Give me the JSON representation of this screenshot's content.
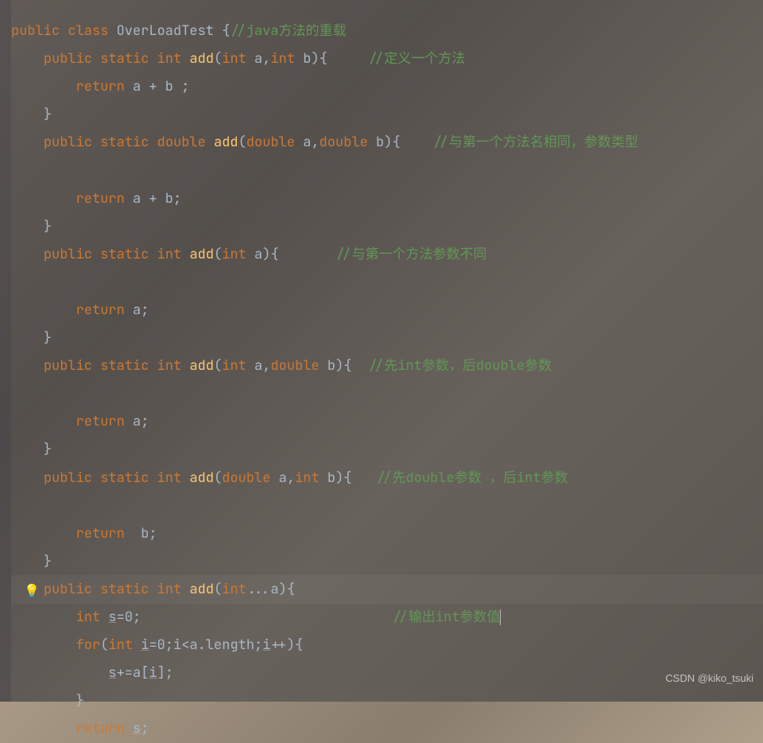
{
  "code": {
    "line1": {
      "kw1": "public",
      "kw2": "class",
      "cls": "OverLoadTest",
      "brace": "{",
      "cmt": "//java方法的重载"
    },
    "line2": {
      "kw1": "public",
      "kw2": "static",
      "ty": "int",
      "fn": "add",
      "sig": "(",
      "ty1": "int",
      "p1": " a",
      "comma": ",",
      "ty2": "int",
      "p2": " b",
      "end": "){",
      "cmt": "//定义一个方法"
    },
    "line3": {
      "kw": "return",
      "expr": " a + b ;"
    },
    "line4": {
      "brace": "}"
    },
    "line5": {
      "kw1": "public",
      "kw2": "static",
      "ty": "double",
      "fn": "add",
      "sig": "(",
      "ty1": "double",
      "p1": " a",
      "comma": ",",
      "ty2": "double",
      "p2": " b",
      "end": "){",
      "cmt": "//与第一个方法名相同，参数类型"
    },
    "line6": {
      "blank": ""
    },
    "line7": {
      "kw": "return",
      "expr": " a + b;"
    },
    "line8": {
      "brace": "}"
    },
    "line9": {
      "kw1": "public",
      "kw2": "static",
      "ty": "int",
      "fn": "add",
      "sig": "(",
      "ty1": "int",
      "p1": " a",
      "end": "){",
      "cmt": "//与第一个方法参数不同"
    },
    "line10": {
      "blank": ""
    },
    "line11": {
      "kw": "return",
      "expr": " a;"
    },
    "line12": {
      "brace": "}"
    },
    "line13": {
      "kw1": "public",
      "kw2": "static",
      "ty": "int",
      "fn": "add",
      "sig": "(",
      "ty1": "int",
      "p1": " a",
      "comma": ",",
      "ty2": "double",
      "p2": " b",
      "end": "){",
      "cmt": "//先int参数，后double参数"
    },
    "line14": {
      "blank": ""
    },
    "line15": {
      "kw": "return",
      "expr": " a;"
    },
    "line16": {
      "brace": "}"
    },
    "line17": {
      "kw1": "public",
      "kw2": "static",
      "ty": "int",
      "fn": "add",
      "sig": "(",
      "ty1": "double",
      "p1": " a",
      "comma": ",",
      "ty2": "int",
      "p2": " b",
      "end": "){",
      "cmt": "//先double参数 ，后int参数"
    },
    "line18": {
      "blank": ""
    },
    "line19": {
      "kw": "return",
      "expr": "  b;"
    },
    "line20": {
      "brace": "}"
    },
    "line21": {
      "kw1": "public",
      "kw2": "static",
      "ty": "int",
      "fn": "add",
      "sig": "(",
      "ty1": "int",
      "p1": "...a",
      "end": "){"
    },
    "line22": {
      "ty": "int",
      "var": "s",
      "eq": "=",
      "val": "0",
      ";": ";",
      "cmt": "//输出int参数值"
    },
    "line23": {
      "kw": "for",
      "sig": "(",
      "ty": "int",
      "var": "i",
      "init": "=0",
      ";": ";",
      "cond": "i<a.length",
      ";2": ";",
      "inc": "i",
      "pp": "++){"
    },
    "line24": {
      "var": "s",
      "op": "+=a[",
      "idx": "i",
      "end": "];"
    },
    "line25": {
      "brace": "}"
    },
    "line26": {
      "kw": "return",
      "var": "s",
      ";": ";"
    }
  },
  "watermark": "CSDN @kiko_tsuki",
  "bulb_icon": "💡"
}
